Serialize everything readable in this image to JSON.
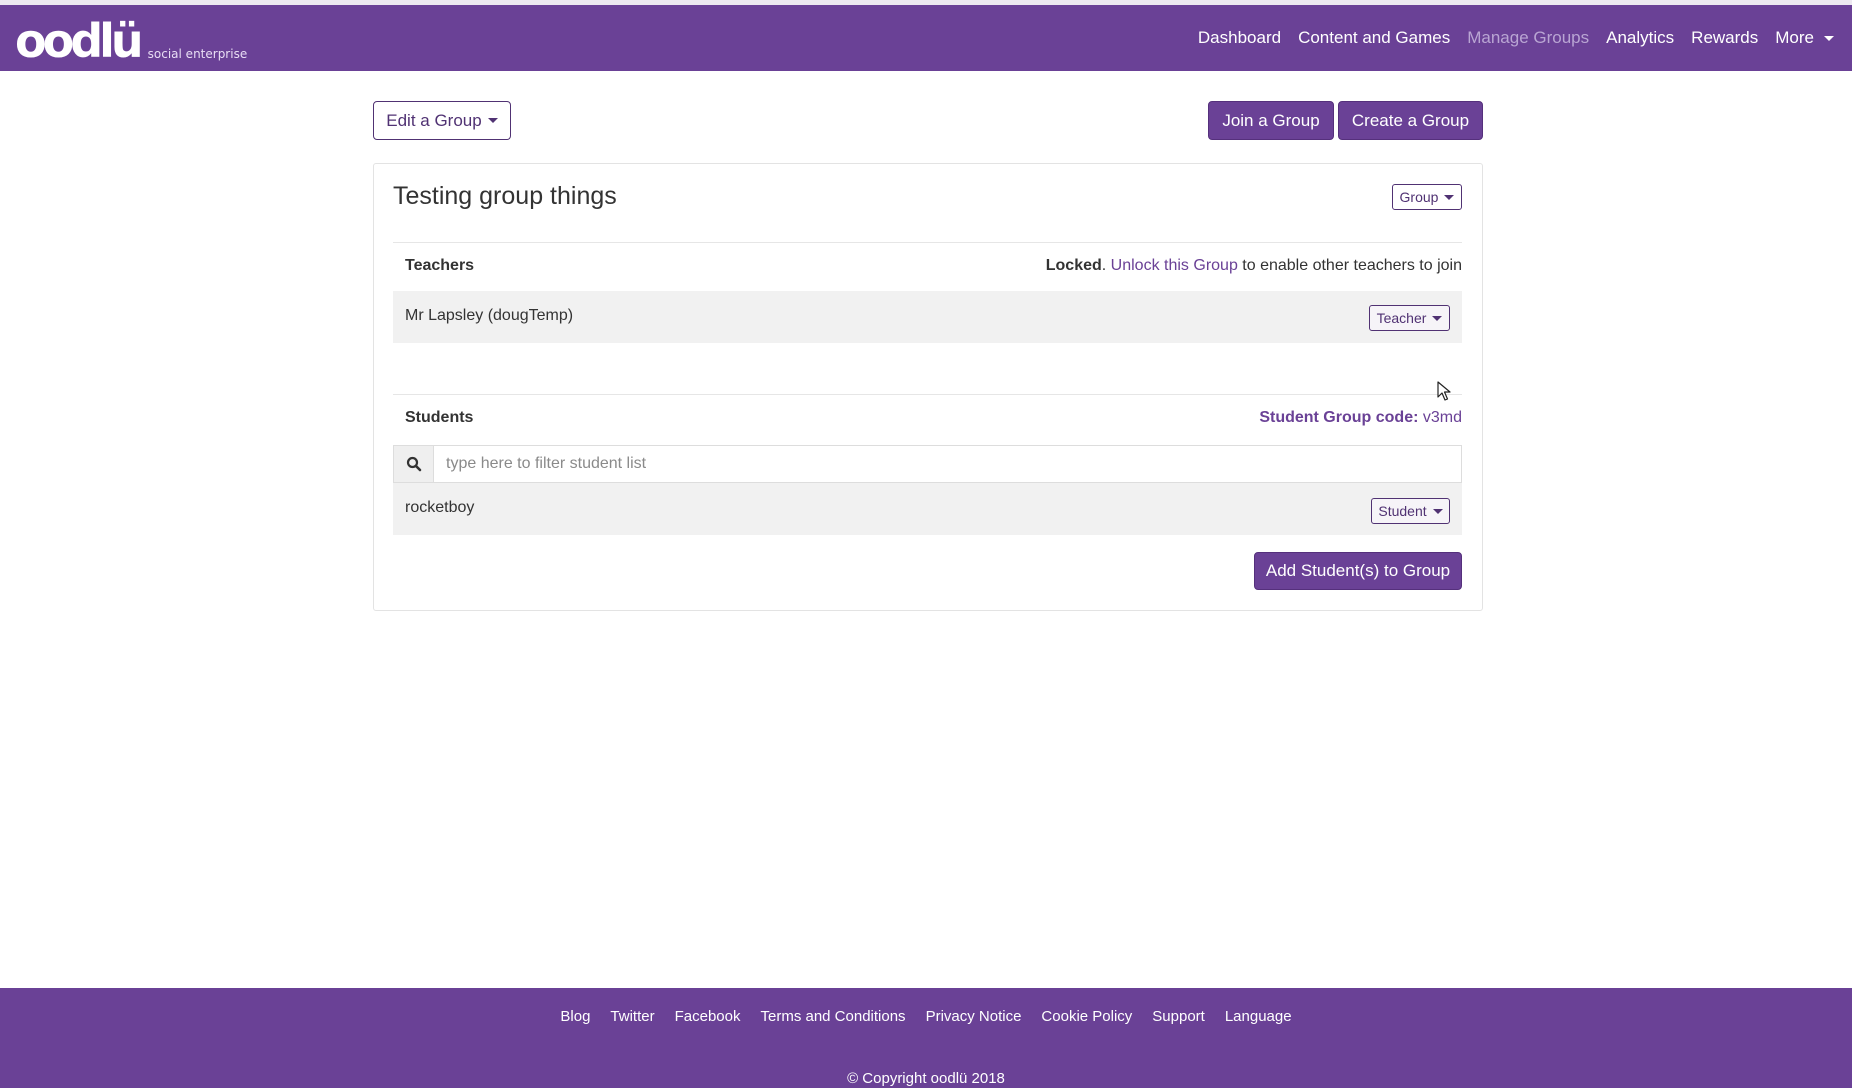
{
  "brand": {
    "logo_text": "oodlü",
    "tagline": "social enterprise",
    "accent": "#6a4196"
  },
  "nav": {
    "items": [
      {
        "label": "Dashboard",
        "active": false
      },
      {
        "label": "Content and Games",
        "active": false
      },
      {
        "label": "Manage Groups",
        "active": true
      },
      {
        "label": "Analytics",
        "active": false
      },
      {
        "label": "Rewards",
        "active": false
      },
      {
        "label": "More",
        "active": false,
        "dropdown": true
      }
    ]
  },
  "toolbar": {
    "edit_group_label": "Edit a Group",
    "join_group_label": "Join a Group",
    "create_group_label": "Create a Group"
  },
  "group": {
    "title": "Testing group things",
    "menu_label": "Group",
    "teachers": {
      "heading": "Teachers",
      "status_bold": "Locked",
      "status_sep": ".",
      "unlock_link": "Unlock this Group",
      "status_tail": "to enable other teachers to join",
      "members": [
        {
          "name": "Mr Lapsley (dougTemp)",
          "role": "Teacher"
        }
      ]
    },
    "students": {
      "heading": "Students",
      "code_label": "Student Group code:",
      "code_value": "v3md",
      "filter_placeholder": "type here to filter student list",
      "filter_value": "",
      "members": [
        {
          "name": "rocketboy",
          "role": "Student"
        }
      ],
      "add_button_label": "Add Student(s) to Group"
    }
  },
  "footer": {
    "links": [
      "Blog",
      "Twitter",
      "Facebook",
      "Terms and Conditions",
      "Privacy Notice",
      "Cookie Policy",
      "Support",
      "Language"
    ],
    "copyright": "© Copyright oodlü 2018"
  }
}
